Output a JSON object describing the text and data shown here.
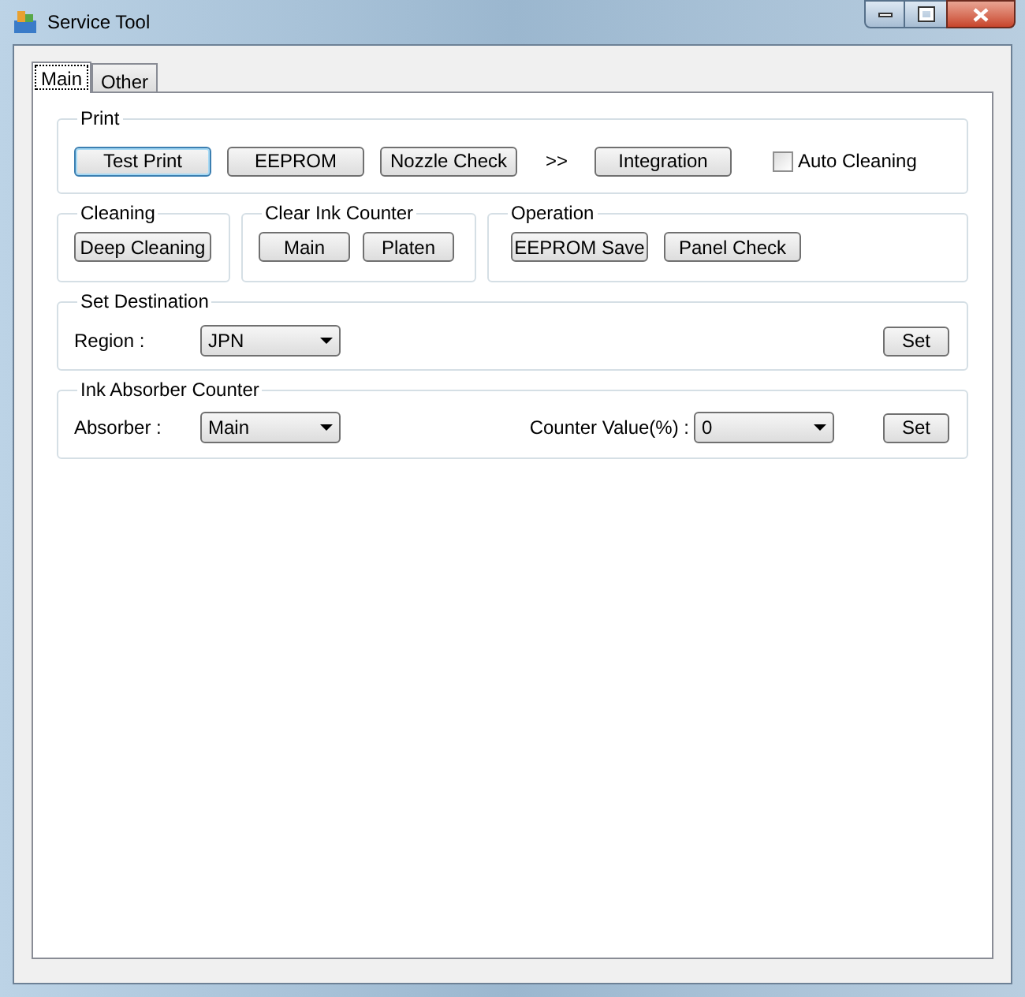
{
  "window": {
    "title": "Service Tool"
  },
  "tabs": [
    {
      "label": "Main",
      "selected": true
    },
    {
      "label": "Other",
      "selected": false
    }
  ],
  "print": {
    "title": "Print",
    "items": [
      {
        "kind": "button",
        "label": "Test Print",
        "focused": true
      },
      {
        "kind": "button",
        "label": "EEPROM",
        "focused": false
      },
      {
        "kind": "button",
        "label": "Nozzle Check",
        "focused": false
      },
      {
        "kind": "arrow",
        "label": ">>"
      },
      {
        "kind": "button",
        "label": "Integration",
        "focused": false
      },
      {
        "kind": "checkbox",
        "label": "Auto Cleaning",
        "checked": false
      }
    ]
  },
  "cleaning": {
    "title": "Cleaning",
    "buttons": [
      {
        "label": "Deep Cleaning",
        "focused": false
      }
    ]
  },
  "clear_ink_counter": {
    "title": "Clear Ink Counter",
    "buttons": [
      {
        "label": "Main",
        "focused": false
      },
      {
        "label": "Platen",
        "focused": false
      }
    ]
  },
  "operation": {
    "title": "Operation",
    "buttons": [
      {
        "label": "EEPROM Save",
        "focused": false
      },
      {
        "label": "Panel Check",
        "focused": false
      }
    ]
  },
  "set_destination": {
    "title": "Set Destination",
    "label": "Region :",
    "value": "JPN",
    "button": "Set"
  },
  "ink_absorber_counter": {
    "title": "Ink Absorber Counter",
    "label": "Absorber :",
    "value": "Main",
    "counter_label": "Counter Value(%) :",
    "counter_value": "0",
    "button": "Set"
  }
}
